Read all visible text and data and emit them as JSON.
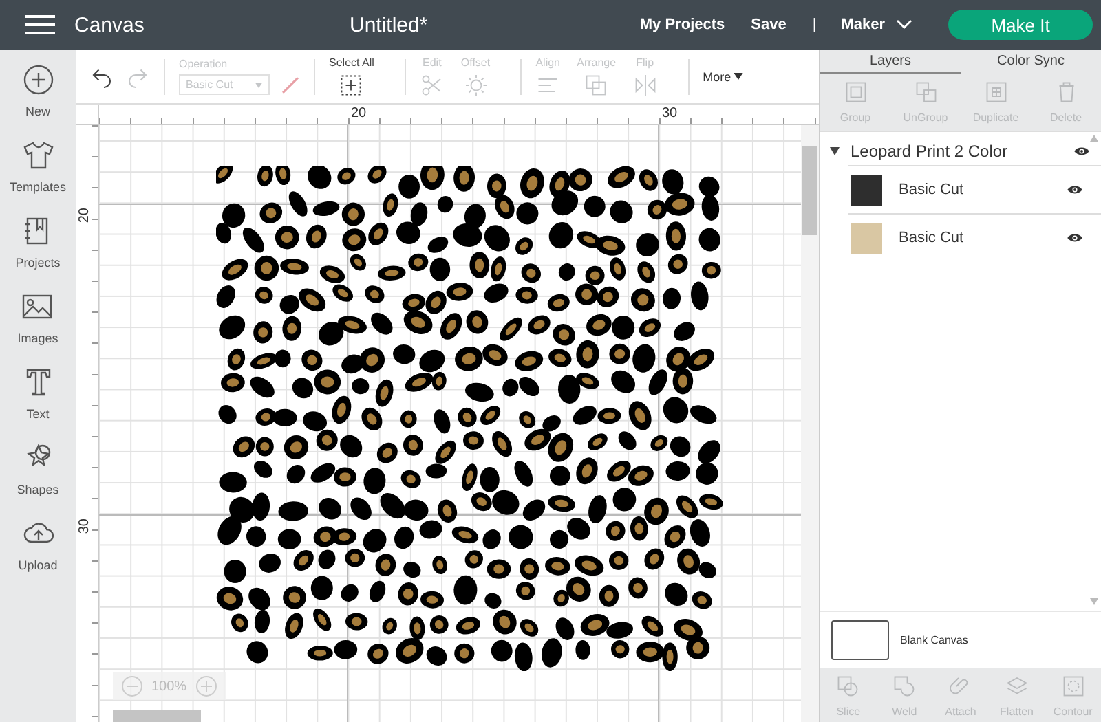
{
  "header": {
    "app_name": "Canvas",
    "document_title": "Untitled*",
    "links": [
      "My Projects",
      "Save"
    ],
    "separator": "|",
    "machine": "Maker",
    "make_it": "Make It"
  },
  "sidebar": {
    "items": [
      {
        "label": "New"
      },
      {
        "label": "Templates"
      },
      {
        "label": "Projects"
      },
      {
        "label": "Images"
      },
      {
        "label": "Text"
      },
      {
        "label": "Shapes"
      },
      {
        "label": "Upload"
      }
    ]
  },
  "toolbar": {
    "undo": {
      "disabled": false
    },
    "redo": {
      "disabled": true
    },
    "operation": {
      "label": "Operation",
      "value": "Basic Cut",
      "disabled": true
    },
    "tools": [
      {
        "label": "Select All",
        "disabled": false
      },
      {
        "label": "Edit",
        "disabled": true
      },
      {
        "label": "Offset",
        "disabled": true
      },
      {
        "label": "Align",
        "disabled": true
      },
      {
        "label": "Arrange",
        "disabled": true
      },
      {
        "label": "Flip",
        "disabled": true
      }
    ],
    "more": "More"
  },
  "canvas": {
    "top_ruler": [
      "20",
      "30"
    ],
    "left_ruler": [
      "20",
      "30"
    ],
    "zoom": "100%"
  },
  "layers_panel": {
    "tabs": [
      {
        "label": "Layers",
        "selected": true
      },
      {
        "label": "Color Sync",
        "selected": false
      }
    ],
    "actions": [
      {
        "label": "Group",
        "disabled": true
      },
      {
        "label": "UnGroup",
        "disabled": true
      },
      {
        "label": "Duplicate",
        "disabled": true
      },
      {
        "label": "Delete",
        "disabled": true
      }
    ],
    "group": {
      "name": "Leopard Print 2 Color",
      "expanded": true,
      "visible": true,
      "children": [
        {
          "name": "Basic Cut",
          "color": "#2e2e2e",
          "visible": true
        },
        {
          "name": "Basic Cut",
          "color": "#d9c7a3",
          "visible": true
        }
      ]
    },
    "blank_canvas": "Blank Canvas",
    "bottom_actions": [
      {
        "label": "Slice",
        "disabled": true
      },
      {
        "label": "Weld",
        "disabled": true
      },
      {
        "label": "Attach",
        "disabled": true
      },
      {
        "label": "Flatten",
        "disabled": true
      },
      {
        "label": "Contour",
        "disabled": true
      }
    ]
  }
}
